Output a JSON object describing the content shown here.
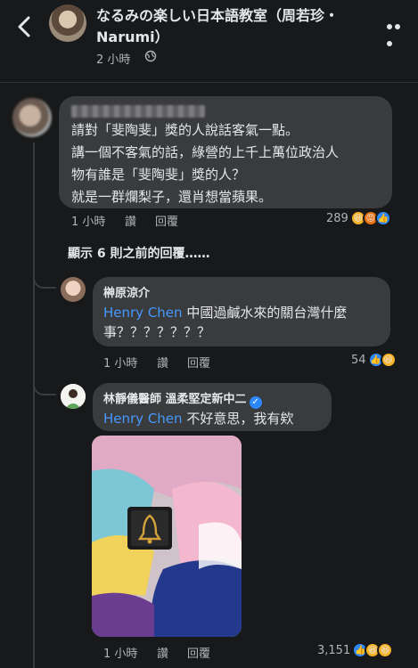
{
  "header": {
    "title": "なるみの楽しい日本語教室（周若珍・ Narumi）",
    "time": "2 小時",
    "privacy_icon": "globe-icon"
  },
  "top_comment": {
    "text_lines": [
      "請對「斐陶斐」獎的人說話客氣一點。",
      "講一個不客氣的話，綠營的上千上萬位政治人",
      "物有誰是「斐陶斐」獎的人？",
      "就是一群爛梨子，還肖想當蘋果。"
    ],
    "time": "1 小時",
    "like_label": "讚",
    "reply_label": "回覆",
    "reaction_count": "289",
    "reactions": [
      "haha",
      "angry",
      "like"
    ]
  },
  "previous_replies": "顯示 6 則之前的回覆……",
  "reply1": {
    "name": "榊原涼介",
    "mention": "Henry Chen",
    "text_line1": " 中國過鹹水來的關台灣什麼",
    "text_line2": "事？？？？？？？",
    "time": "1 小時",
    "like_label": "讚",
    "reply_label": "回覆",
    "reaction_count": "54",
    "reactions": [
      "like",
      "haha"
    ]
  },
  "reply2": {
    "name": "林靜儀醫師 溫柔堅定新中二",
    "mention": "Henry Chen",
    "text": " 不好意思，我有欸",
    "time": "1 小時",
    "like_label": "讚",
    "reply_label": "回覆",
    "reaction_count": "3,151",
    "reactions": [
      "like",
      "haha",
      "haha"
    ]
  }
}
